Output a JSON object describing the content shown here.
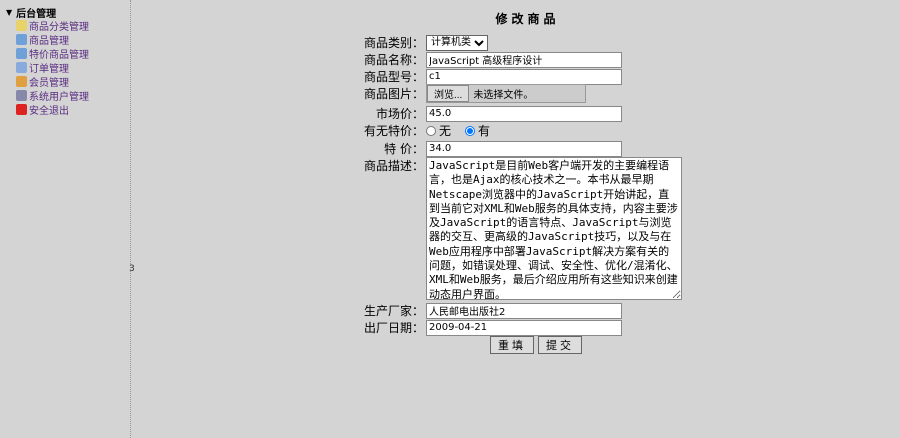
{
  "sidebar": {
    "root": "后台管理",
    "items": [
      {
        "label": "商品分类管理",
        "icon": "edit-icon",
        "color": "#e8d36a"
      },
      {
        "label": "商品管理",
        "icon": "folder-icon",
        "color": "#6fa0d8"
      },
      {
        "label": "特价商品管理",
        "icon": "folder-icon",
        "color": "#6fa0d8"
      },
      {
        "label": "订单管理",
        "icon": "list-icon",
        "color": "#88aadd"
      },
      {
        "label": "会员管理",
        "icon": "users-icon",
        "color": "#e0a040"
      },
      {
        "label": "系统用户管理",
        "icon": "user-icon",
        "color": "#8888aa"
      },
      {
        "label": "安全退出",
        "icon": "close-icon",
        "color": "#dd2222"
      }
    ]
  },
  "splitter": "3",
  "form": {
    "title": "修改商品",
    "category_label": "商品类别：",
    "category_value": "计算机类",
    "name_label": "商品名称：",
    "name_value": "JavaScript 高级程序设计",
    "model_label": "商品型号：",
    "model_value": "c1",
    "image_label": "商品图片：",
    "browse_label": "浏览...",
    "no_file": "未选择文件。",
    "market_label": "市场价：",
    "market_value": "45.0",
    "special_label": "有无特价：",
    "special_no": "无",
    "special_yes": "有",
    "special_selected": "有",
    "price_label": "特 价：",
    "price_value": "34.0",
    "desc_label": "商品描述：",
    "desc_value": "JavaScript是目前Web客户端开发的主要编程语言，也是Ajax的核心技术之一。本书从最早期Netscape浏览器中的JavaScript开始讲起，直到当前它对XML和Web服务的具体支持，内容主要涉及JavaScript的语言特点、JavaScript与浏览器的交互、更高级的JavaScript技巧，以及与在Web应用程序中部署JavaScript解决方案有关的问题，如错误处理、调试、安全性、优化/混淆化、XML和Web服务，最后介绍应用所有这些知识来创建动态用户界面。",
    "factory_label": "生产厂家：",
    "factory_value": "人民邮电出版社2",
    "date_label": "出厂日期：",
    "date_value": "2009-04-21",
    "reset_label": "重填",
    "submit_label": "提交"
  }
}
